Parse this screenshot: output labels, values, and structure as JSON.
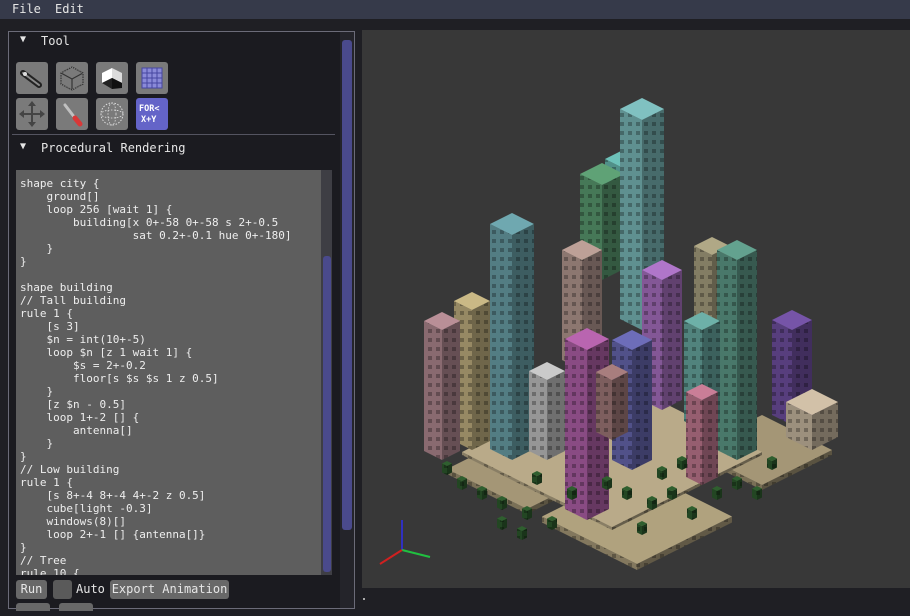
{
  "menu": {
    "file": "File",
    "edit": "Edit"
  },
  "tool_panel": {
    "tool_header": "Tool",
    "tools_row1": [
      "pen-icon",
      "wireframe-cube-icon",
      "solid-cube-icon",
      "grid-icon"
    ],
    "tools_row2": [
      "move-arrows-icon",
      "brush-icon",
      "sphere-icon",
      "for-loop-icon"
    ],
    "for_label_top": "FOR<",
    "for_label_bottom": "X+Y",
    "procedural_header": "Procedural Rendering"
  },
  "code": {
    "text": "shape city {\n    ground[]\n    loop 256 [wait 1] {\n        building[x 0+-58 0+-58 s 2+-0.5\n                 sat 0.2+-0.1 hue 0+-180]\n    }\n}\n\nshape building\n// Tall building\nrule 1 {\n    [s 3]\n    $n = int(10+-5)\n    loop $n [z 1 wait 1] {\n        $s = 2+-0.2\n        floor[s $s $s 1 z 0.5]\n    }\n    [z $n - 0.5]\n    loop 1+-2 [] {\n        antenna[]\n    }\n}\n// Low building\nrule 1 {\n    [s 8+-4 8+-4 4+-2 z 0.5]\n    cube[light -0.3]\n    windows(8)[]\n    loop 2+-1 [] {antenna[]}\n}\n// Tree\nrule 10 {"
  },
  "controls": {
    "run": "Run",
    "auto": "Auto",
    "auto_checked": false,
    "export": "Export Animation"
  },
  "colors": {
    "menubar": "#363a4a",
    "accent": "#6464c8",
    "button": "#686868",
    "viewport_bg": "#383838"
  }
}
